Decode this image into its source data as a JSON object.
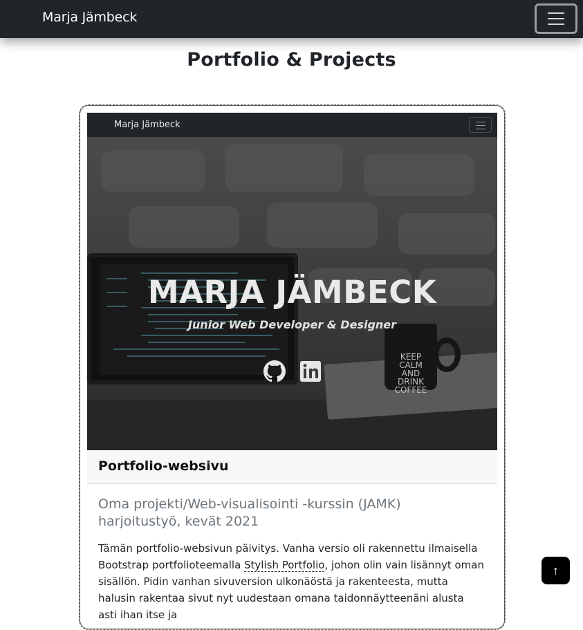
{
  "navbar": {
    "brand": "Marja Jämbeck",
    "toggler_icon": "hamburger-icon"
  },
  "page": {
    "title": "Portfolio & Projects"
  },
  "project": {
    "screenshot": {
      "brand": "Marja Jämbeck",
      "hero_title": "MARJA JÄMBECK",
      "hero_subtitle": "Junior Web Developer & Designer",
      "mug_text": "KEEP\nCALM\nAND\nDRINK\nCOFFEE",
      "icons": [
        "github-icon",
        "linkedin-icon"
      ]
    },
    "header": "Portfolio-websivu",
    "subtitle": "Oma projekti/Web-visualisointi -kurssin (JAMK) harjoitustyö, kevät 2021",
    "text_before_link": "Tämän portfolio-websivun päivitys. Vanha versio oli rakennettu ilmaisella Bootstrap portfolioteemalla ",
    "link_text": "Stylish Portfolio",
    "text_after_link": ", johon olin vain lisännyt oman sisällön. Pidin vanhan sivuversion ulkonäöstä ja rakenteesta, mutta halusin rakentaa sivut nyt uudestaan omana taidonnäytteenäni alusta asti ihan itse ja"
  },
  "back_to_top": {
    "label": "↑",
    "icon": "arrow-up-icon"
  }
}
